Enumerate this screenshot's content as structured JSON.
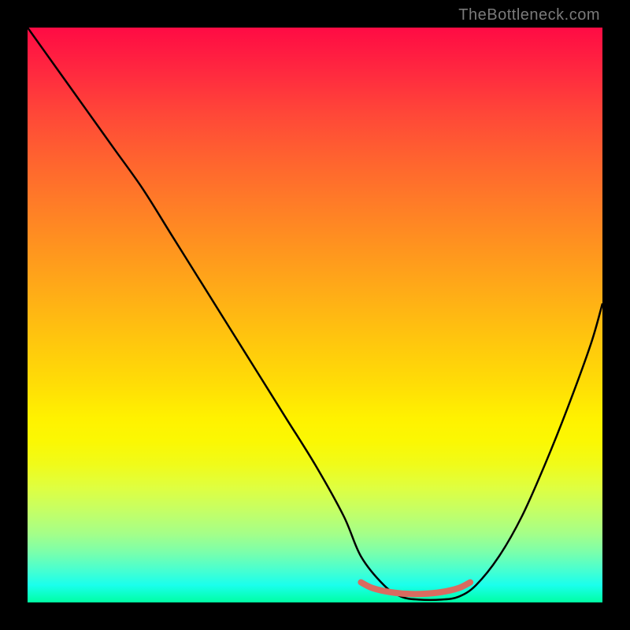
{
  "watermark": "TheBottleneck.com",
  "chart_data": {
    "type": "line",
    "title": "",
    "xlabel": "",
    "ylabel": "",
    "xlim": [
      0,
      100
    ],
    "ylim": [
      0,
      100
    ],
    "grid": false,
    "legend": false,
    "series": [
      {
        "name": "bottleneck-curve",
        "color": "#000000",
        "x": [
          0,
          5,
          10,
          15,
          20,
          25,
          30,
          35,
          40,
          45,
          50,
          55,
          58,
          62,
          65,
          68,
          72,
          75,
          78,
          82,
          86,
          90,
          94,
          98,
          100
        ],
        "y": [
          100,
          93,
          86,
          79,
          72,
          64,
          56,
          48,
          40,
          32,
          24,
          15,
          8,
          3,
          1,
          0.5,
          0.5,
          1,
          3,
          8,
          15,
          24,
          34,
          45,
          52
        ]
      },
      {
        "name": "optimal-zone",
        "color": "#d96b60",
        "x": [
          58,
          60,
          63,
          66,
          69,
          72,
          75,
          77
        ],
        "y": [
          3.5,
          2.5,
          1.8,
          1.5,
          1.5,
          1.8,
          2.5,
          3.5
        ]
      }
    ],
    "background_gradient": {
      "type": "vertical",
      "stops": [
        {
          "pos": 0,
          "color": "#ff0b44"
        },
        {
          "pos": 50,
          "color": "#ffc50e"
        },
        {
          "pos": 75,
          "color": "#fbf803"
        },
        {
          "pos": 100,
          "color": "#00ffa3"
        }
      ]
    },
    "annotations": []
  }
}
